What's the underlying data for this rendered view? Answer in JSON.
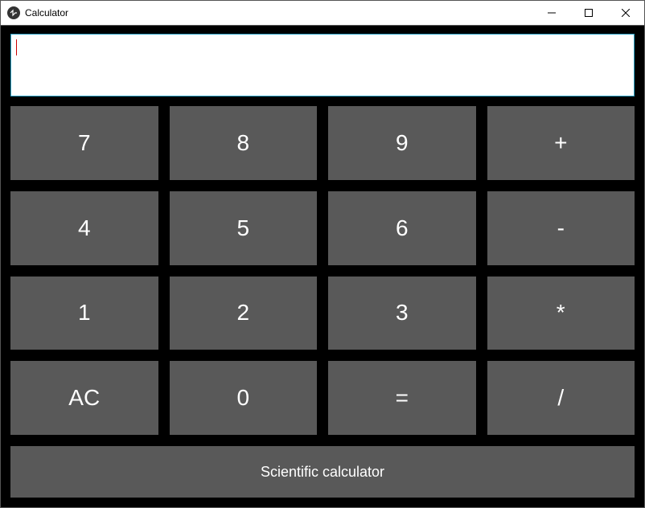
{
  "window": {
    "title": "Calculator"
  },
  "display": {
    "value": ""
  },
  "keys": {
    "r1c1": "7",
    "r1c2": "8",
    "r1c3": "9",
    "r1c4": "+",
    "r2c1": "4",
    "r2c2": "5",
    "r2c3": "6",
    "r2c4": "-",
    "r3c1": "1",
    "r3c2": "2",
    "r3c3": "3",
    "r3c4": "*",
    "r4c1": "AC",
    "r4c2": "0",
    "r4c3": "=",
    "r4c4": "/",
    "scientific": "Scientific calculator"
  }
}
